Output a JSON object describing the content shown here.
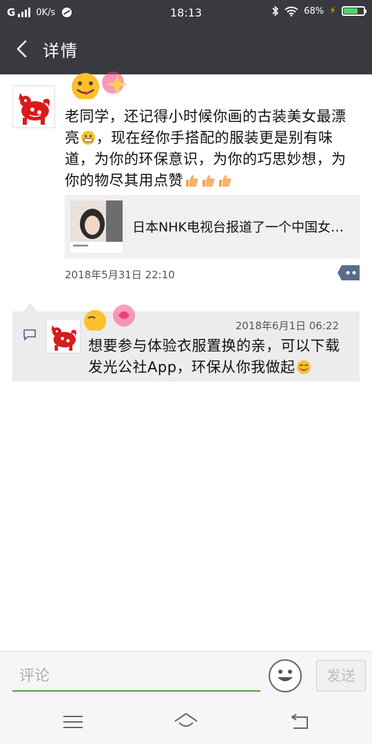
{
  "status_bar": {
    "network": "G",
    "speed": "0K/s",
    "time": "18:13",
    "battery": "68%",
    "battery_color": "#4cd964"
  },
  "header": {
    "title": "详情",
    "back_icon": "chevron-left-icon",
    "background": "#393a3f"
  },
  "post": {
    "text_part1": "老同学，还记得小时候你画的古装美女最漂亮",
    "text_part2": "，现在经你手搭配的服装更是别有味道，为你的环保意识，为你的巧思妙想，为你的物尽其用点赞",
    "link_title": "日本NHK电视台报道了一个中国女…",
    "time": "2018年5月31日 22:10"
  },
  "reply": {
    "time": "2018年6月1日 06:22",
    "text": "想要参与体验衣服置换的亲，可以下载发光公社App，环保从你我做起"
  },
  "comment_bar": {
    "placeholder": "评论",
    "send_label": "发送",
    "accent": "#4aa63b"
  },
  "nav": {
    "menu_icon": "menu-icon",
    "home_icon": "home-icon",
    "back_icon": "back-icon"
  }
}
